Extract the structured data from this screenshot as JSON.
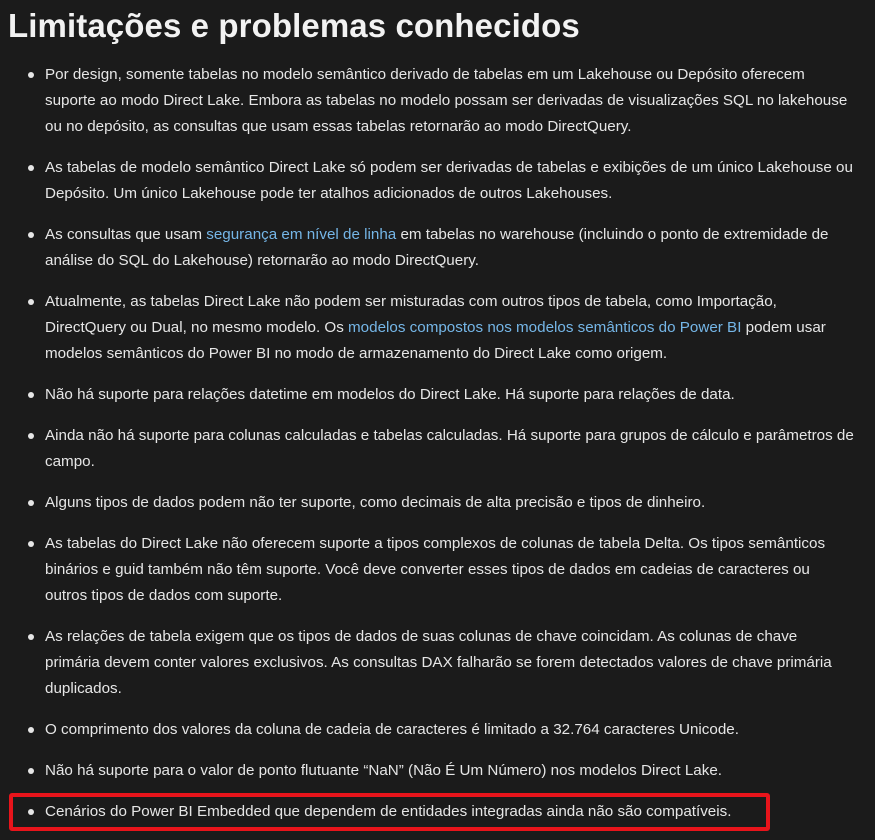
{
  "title": "Limitações e problemas conhecidos",
  "colors": {
    "background": "#1b1b1b",
    "text": "#e6e6e6",
    "link": "#75b6e7",
    "highlight": "#e8141b"
  },
  "items": [
    {
      "text": "Por design, somente tabelas no modelo semântico derivado de tabelas em um Lakehouse ou Depósito oferecem suporte ao modo Direct Lake. Embora as tabelas no modelo possam ser derivadas de visualizações SQL no lakehouse ou no depósito, as consultas que usam essas tabelas retornarão ao modo DirectQuery."
    },
    {
      "text": "As tabelas de modelo semântico Direct Lake só podem ser derivadas de tabelas e exibições de um único Lakehouse ou Depósito. Um único Lakehouse pode ter atalhos adicionados de outros Lakehouses."
    },
    {
      "pre": "As consultas que usam ",
      "link": "segurança em nível de linha",
      "post": " em tabelas no warehouse (incluindo o ponto de extremidade de análise do SQL do Lakehouse) retornarão ao modo DirectQuery."
    },
    {
      "pre": "Atualmente, as tabelas Direct Lake não podem ser misturadas com outros tipos de tabela, como Importação, DirectQuery ou Dual, no mesmo modelo. Os ",
      "link": "modelos compostos nos modelos semânticos do Power BI",
      "post": " podem usar modelos semânticos do Power BI no modo de armazenamento do Direct Lake como origem."
    },
    {
      "text": "Não há suporte para relações datetime em modelos do Direct Lake. Há suporte para relações de data."
    },
    {
      "text": "Ainda não há suporte para colunas calculadas e tabelas calculadas. Há suporte para grupos de cálculo e parâmetros de campo."
    },
    {
      "text": "Alguns tipos de dados podem não ter suporte, como decimais de alta precisão e tipos de dinheiro."
    },
    {
      "text": "As tabelas do Direct Lake não oferecem suporte a tipos complexos de colunas de tabela Delta. Os tipos semânticos binários e guid também não têm suporte. Você deve converter esses tipos de dados em cadeias de caracteres ou outros tipos de dados com suporte."
    },
    {
      "text": "As relações de tabela exigem que os tipos de dados de suas colunas de chave coincidam. As colunas de chave primária devem conter valores exclusivos. As consultas DAX falharão se forem detectados valores de chave primária duplicados."
    },
    {
      "text": "O comprimento dos valores da coluna de cadeia de caracteres é limitado a 32.764 caracteres Unicode."
    },
    {
      "text": "Não há suporte para o valor de ponto flutuante “NaN” (Não É Um Número) nos modelos Direct Lake."
    },
    {
      "text": "Cenários do Power BI Embedded que dependem de entidades integradas ainda não são compatíveis."
    }
  ]
}
